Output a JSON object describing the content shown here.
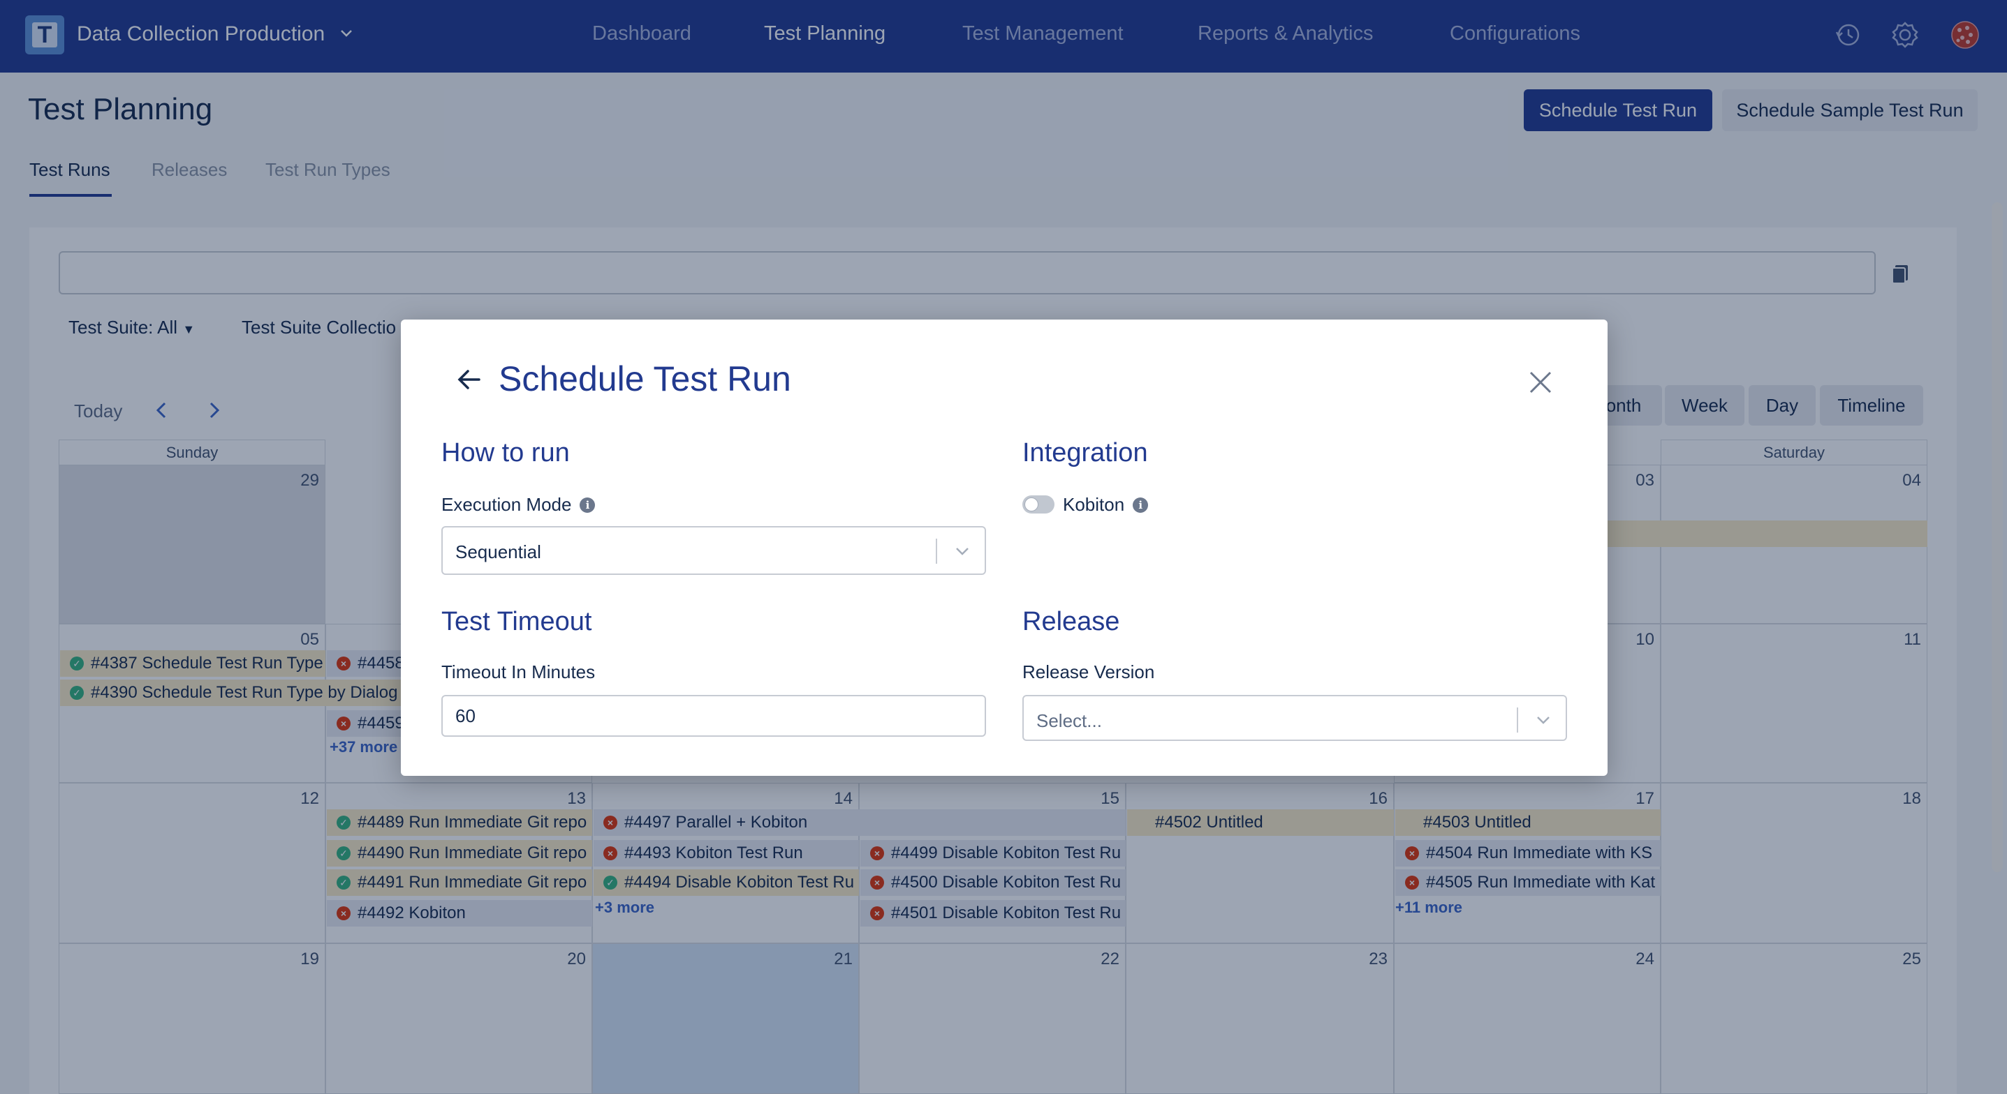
{
  "app": {
    "name": "Data Collection Production",
    "logo_letter": "T"
  },
  "nav": [
    {
      "label": "Dashboard",
      "active": false
    },
    {
      "label": "Test Planning",
      "active": true
    },
    {
      "label": "Test Management",
      "active": false
    },
    {
      "label": "Reports & Analytics",
      "active": false
    },
    {
      "label": "Configurations",
      "active": false
    }
  ],
  "topbar_icons": [
    "history-icon",
    "gear-icon",
    "globe-avatar-icon"
  ],
  "page": {
    "title": "Test Planning",
    "primary_button": "Schedule Test Run",
    "secondary_button": "Schedule Sample Test Run",
    "tabs": [
      {
        "label": "Test Runs",
        "active": true
      },
      {
        "label": "Releases",
        "active": false
      },
      {
        "label": "Test Run Types",
        "active": false
      }
    ]
  },
  "filters": {
    "suite": "Test Suite: All",
    "collection": "Test Suite Collectio"
  },
  "calendar": {
    "today_label": "Today",
    "views": [
      "onth",
      "Week",
      "Day",
      "Timeline"
    ],
    "weekdays": {
      "sun": "Sunday",
      "sat": "Saturday"
    },
    "weeks": [
      [
        "29",
        "",
        "",
        "",
        "",
        "03",
        "04"
      ],
      [
        "05",
        "",
        "",
        "",
        "",
        "10",
        "11"
      ],
      [
        "12",
        "13",
        "14",
        "15",
        "16",
        "17",
        "18"
      ],
      [
        "19",
        "20",
        "21",
        "22",
        "23",
        "24",
        "25"
      ]
    ],
    "events": {
      "w2_sun_1": "#4387 Schedule Test Run Type",
      "w2_sun_2": "#4390 Schedule Test Run Type by Dialog",
      "w2_mon_1": "#4458",
      "w2_mon_2": "#4459",
      "w2_mon_more": "+37 more",
      "w3_mon_1": "#4489 Run Immediate Git repo",
      "w3_mon_2": "#4490 Run Immediate Git repo",
      "w3_mon_3": "#4491 Run Immediate Git repo",
      "w3_mon_4": "#4492 Kobiton",
      "w3_tue_1": "#4497 Parallel + Kobiton",
      "w3_tue_2": "#4493 Kobiton Test Run",
      "w3_tue_3": "#4494 Disable Kobiton Test Ru",
      "w3_tue_more": "+3 more",
      "w3_wed_1": "#4499 Disable Kobiton Test Ru",
      "w3_wed_2": "#4500 Disable Kobiton Test Ru",
      "w3_wed_3": "#4501 Disable Kobiton Test Ru",
      "w3_thu_1": "#4502 Untitled",
      "w3_fri_1": "#4503 Untitled",
      "w3_fri_2": "#4504 Run Immediate with KS",
      "w3_fri_3": "#4505 Run Immediate with Kat",
      "w3_fri_more": "+11 more"
    }
  },
  "modal": {
    "title": "Schedule Test Run",
    "how_to_run": {
      "title": "How to run",
      "execution_label": "Execution Mode",
      "execution_value": "Sequential"
    },
    "integration": {
      "title": "Integration",
      "kobiton_label": "Kobiton",
      "kobiton_enabled": false
    },
    "timeout": {
      "title": "Test Timeout",
      "label": "Timeout In Minutes",
      "value": "60"
    },
    "release": {
      "title": "Release",
      "label": "Release Version",
      "placeholder": "Select..."
    }
  },
  "colors": {
    "topbar": "#223a8f",
    "accent": "#223a8f",
    "success": "#36b37e",
    "error": "#de350b",
    "event_bg": "#fbecc7"
  }
}
